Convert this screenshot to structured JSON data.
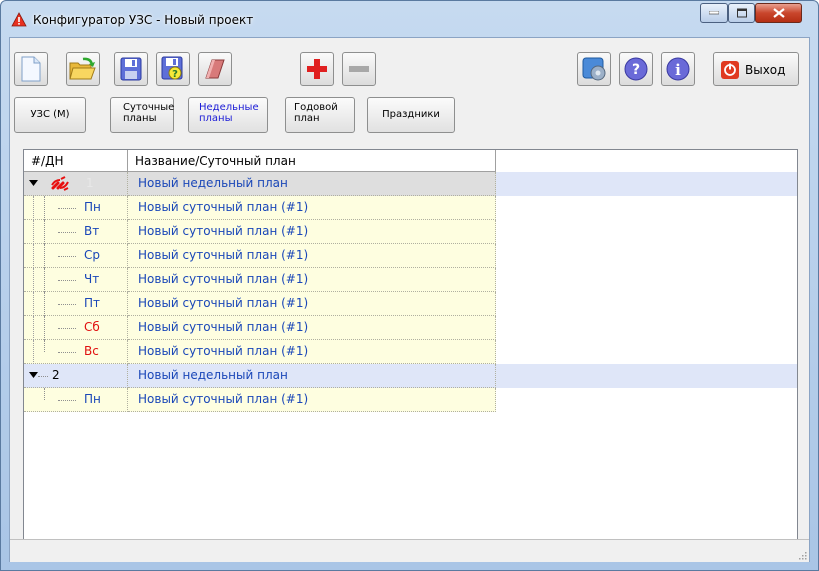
{
  "window": {
    "title": "Конфигуратор УЗС - Новый проект",
    "buttons": {
      "minimize": "minimize-icon",
      "maximize": "maximize-icon",
      "close": "close-icon"
    }
  },
  "toolbar": {
    "icons": [
      "new-document-icon",
      "open-folder-icon",
      "save-icon",
      "save-as-icon",
      "eraser-icon",
      "add-icon",
      "remove-icon"
    ],
    "right_icons": [
      "settings-icon",
      "help-icon",
      "info-icon"
    ],
    "exit_label": "Выход"
  },
  "nav": {
    "uzs": "УЗС (М)",
    "daily": [
      "Суточные",
      "планы"
    ],
    "weekly": [
      "Недельные",
      "планы"
    ],
    "yearly": [
      "Годовой",
      "план"
    ],
    "holidays": "Праздники"
  },
  "grid": {
    "columns": [
      "#/ДН",
      "Название/Суточный план"
    ],
    "plan1": {
      "number": "1",
      "name": "Новый недельный план"
    },
    "days1": [
      {
        "day": "Пн",
        "plan": "Новый суточный план (#1)",
        "weekend": false
      },
      {
        "day": "Вт",
        "plan": "Новый суточный план (#1)",
        "weekend": false
      },
      {
        "day": "Ср",
        "plan": "Новый суточный план (#1)",
        "weekend": false
      },
      {
        "day": "Чт",
        "plan": "Новый суточный план (#1)",
        "weekend": false
      },
      {
        "day": "Пт",
        "plan": "Новый суточный план (#1)",
        "weekend": false
      },
      {
        "day": "Сб",
        "plan": "Новый суточный план (#1)",
        "weekend": true
      },
      {
        "day": "Вс",
        "plan": "Новый суточный план (#1)",
        "weekend": true
      }
    ],
    "plan2": {
      "number": "2",
      "name": "Новый недельный план"
    },
    "days2": [
      {
        "day": "Пн",
        "plan": "Новый суточный план (#1)",
        "weekend": false
      }
    ]
  },
  "colors": {
    "link_blue": "#1a47b8",
    "weekend_red": "#e01010",
    "row_yellow": "#fefee0",
    "row_selected": "#dfe6f8"
  }
}
